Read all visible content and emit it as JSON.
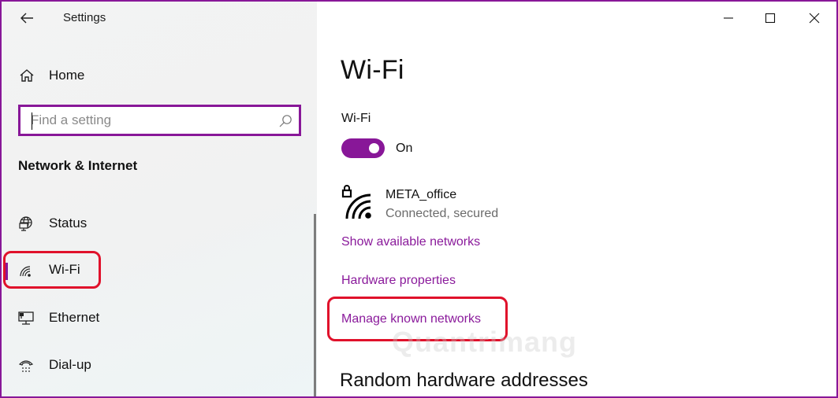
{
  "window": {
    "title": "Settings",
    "accent_color": "#881798",
    "highlight_color": "#e0112b",
    "caption_buttons": [
      "minimize",
      "maximize",
      "close"
    ]
  },
  "sidebar": {
    "back_icon": "back-arrow-icon",
    "home": {
      "label": "Home",
      "icon": "home-icon"
    },
    "search": {
      "placeholder": "Find a setting",
      "value": "",
      "icon": "search-icon"
    },
    "section_title": "Network & Internet",
    "items": [
      {
        "label": "Status",
        "icon": "globe-status-icon",
        "active": false
      },
      {
        "label": "Wi-Fi",
        "icon": "wifi-icon",
        "active": true,
        "highlighted": true
      },
      {
        "label": "Ethernet",
        "icon": "ethernet-icon",
        "active": false
      },
      {
        "label": "Dial-up",
        "icon": "dial-up-phone-icon",
        "active": false
      }
    ]
  },
  "main": {
    "page_title": "Wi-Fi",
    "wifi_toggle": {
      "label": "Wi-Fi",
      "state": "On",
      "enabled": true
    },
    "network": {
      "name": "META_office",
      "status": "Connected, secured",
      "icon": "wifi-secured-icon"
    },
    "links": [
      {
        "label": "Show available networks"
      },
      {
        "label": "Hardware properties"
      },
      {
        "label": "Manage known networks",
        "highlighted": true
      }
    ],
    "section_heading": "Random hardware addresses"
  },
  "watermark": "Quantrimang"
}
